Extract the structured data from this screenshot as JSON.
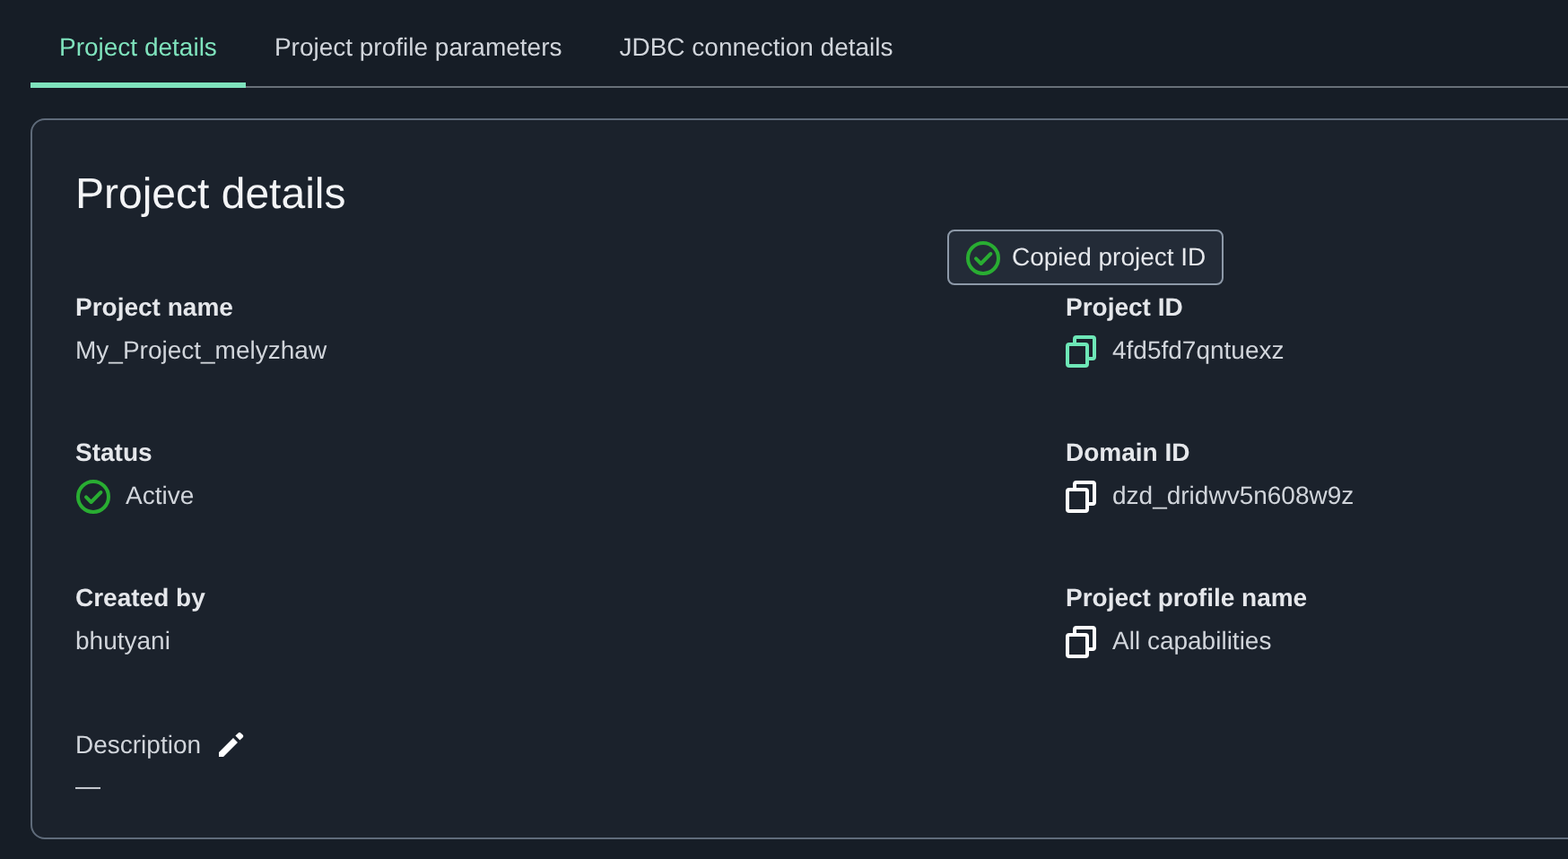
{
  "tabs": [
    {
      "label": "Project details",
      "selected": true
    },
    {
      "label": "Project profile parameters",
      "selected": false
    },
    {
      "label": "JDBC connection details",
      "selected": false
    }
  ],
  "card": {
    "title": "Project details",
    "left_fields": [
      {
        "kind": "text",
        "label": "Project name",
        "value": "My_Project_melyzhaw"
      },
      {
        "kind": "status",
        "label": "Status",
        "value": "Active"
      },
      {
        "kind": "text",
        "label": "Created by",
        "value": "bhutyani"
      },
      {
        "kind": "editable",
        "label": "Description",
        "value": "—"
      }
    ],
    "right_fields": [
      {
        "kind": "copy",
        "label": "Project ID",
        "value": "4fd5fd7qntuexz",
        "copied": true,
        "popover": "Copied project ID"
      },
      {
        "kind": "copy",
        "label": "Domain ID",
        "value": "dzd_dridwv5n608w9z",
        "copied": false
      },
      {
        "kind": "copy",
        "label": "Project profile name",
        "value": "All capabilities",
        "copied": false
      }
    ]
  }
}
